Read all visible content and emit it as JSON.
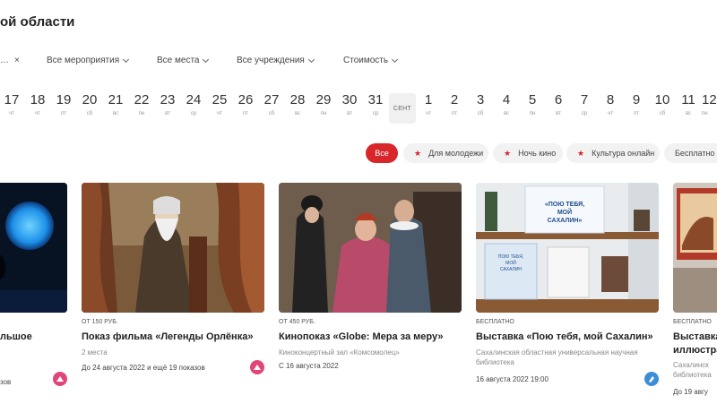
{
  "page": {
    "title": "ой области"
  },
  "filters": {
    "active_chip": "…",
    "chip_close": "×",
    "dropdowns": [
      "Все мероприятия",
      "Все места",
      "Все учреждения",
      "Стоимость"
    ]
  },
  "calendar": {
    "days": [
      {
        "num": "17",
        "wd": "чт"
      },
      {
        "num": "18",
        "wd": "чт"
      },
      {
        "num": "19",
        "wd": "пт"
      },
      {
        "num": "20",
        "wd": "сб"
      },
      {
        "num": "21",
        "wd": "вс"
      },
      {
        "num": "22",
        "wd": "пн"
      },
      {
        "num": "23",
        "wd": "вт"
      },
      {
        "num": "24",
        "wd": "ср"
      },
      {
        "num": "25",
        "wd": "чт"
      },
      {
        "num": "26",
        "wd": "пт"
      },
      {
        "num": "27",
        "wd": "сб"
      },
      {
        "num": "28",
        "wd": "вс"
      },
      {
        "num": "29",
        "wd": "пн"
      },
      {
        "num": "30",
        "wd": "вт"
      },
      {
        "num": "31",
        "wd": "ср"
      }
    ],
    "month_label": "СЕНТ",
    "days_next": [
      {
        "num": "1",
        "wd": "чт"
      },
      {
        "num": "2",
        "wd": "пт"
      },
      {
        "num": "3",
        "wd": "сб"
      },
      {
        "num": "4",
        "wd": "вс"
      },
      {
        "num": "5",
        "wd": "пн"
      },
      {
        "num": "6",
        "wd": "вт"
      },
      {
        "num": "7",
        "wd": "ср"
      },
      {
        "num": "8",
        "wd": "чт"
      },
      {
        "num": "9",
        "wd": "пт"
      },
      {
        "num": "10",
        "wd": "сб"
      },
      {
        "num": "11",
        "wd": "вс"
      },
      {
        "num": "12",
        "wd": "пн"
      }
    ]
  },
  "categories": {
    "all": "Все",
    "items": [
      "Для молодежи",
      "Ночь кино",
      "Культура онлайн"
    ],
    "free": "Бесплатно"
  },
  "cards": [
    {
      "price": "",
      "title": "льшое",
      "sub": "",
      "date": "зов"
    },
    {
      "price": "ОТ 150 РУБ.",
      "title": "Показ фильма «Легенды Орлёнка»",
      "sub": "2 места",
      "date": "До 24 августа 2022 и ещё 19 показов"
    },
    {
      "price": "ОТ 450 РУБ.",
      "title": "Кинопоказ «Globe: Мера за меру»",
      "sub": "Киноконцертный зал «Комсомолец»",
      "date": "С 16 августа 2022"
    },
    {
      "price": "БЕСПЛАТНО",
      "title": "Выставка «Пою тебя, мой Сахалин»",
      "sub": "Сахалинская областная универсальная научная библиотека",
      "date": "16 августа 2022 19:00",
      "banner": [
        "«ПОЮ ТЕБЯ,",
        "МОЙ",
        "САХАЛИН»"
      ],
      "poster": [
        "ПОЮ ТЕБЯ,",
        "МОЙ",
        "САХАЛИН"
      ]
    },
    {
      "price": "БЕСПЛАТНО",
      "title": "Выставка",
      "title2": "иллюстра",
      "sub": "Сахалинск библиотека",
      "date": "До 19 авгу"
    }
  ],
  "colors": {
    "accent": "#d8262a",
    "pill_bg": "#f2f2f2",
    "badge_pink": "#e0457b",
    "badge_blue": "#3c8fd6"
  },
  "icons": {
    "close": "close-icon",
    "chevron": "chevron-down-icon",
    "star": "star-icon",
    "badge": "pushkin-card-icon",
    "library": "library-icon"
  }
}
